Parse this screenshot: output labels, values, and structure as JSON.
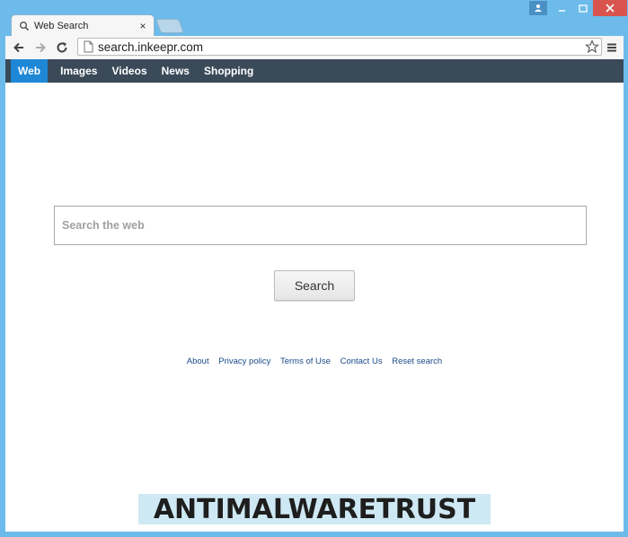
{
  "browser": {
    "tab_title": "Web Search",
    "tab_close": "×",
    "url": "search.inkeepr.com",
    "window_controls": {
      "minimize": "—",
      "maximize": "▭",
      "close": "✕"
    }
  },
  "navbar": {
    "items": [
      {
        "label": "Web",
        "active": true
      },
      {
        "label": "Images"
      },
      {
        "label": "Videos"
      },
      {
        "label": "News"
      },
      {
        "label": "Shopping"
      }
    ]
  },
  "search": {
    "placeholder": "Search the web",
    "value": "",
    "button_label": "Search"
  },
  "footer": {
    "links": [
      "About",
      "Privacy policy",
      "Terms of Use",
      "Contact Us",
      "Reset search"
    ]
  },
  "watermark": {
    "text": "ANTIMALWARETRUST"
  },
  "colors": {
    "frame": "#6cbbeb",
    "navbar": "#3b4a59",
    "nav_active": "#1e87d6",
    "link": "#1a4a8a",
    "close_button": "#d9534f"
  }
}
